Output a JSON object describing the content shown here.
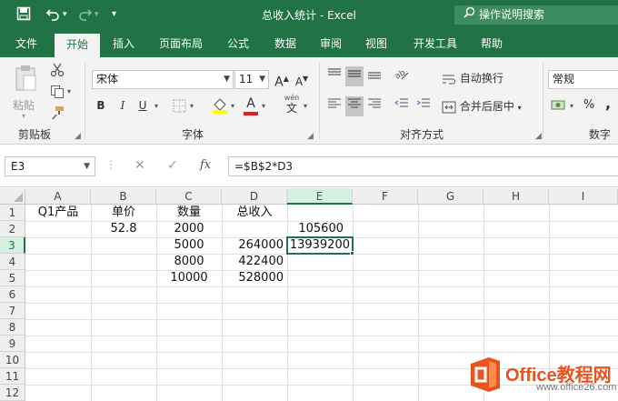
{
  "window": {
    "title": "总收入统计  -  Excel",
    "tell_me": "操作说明搜索"
  },
  "qat": {
    "save_icon": "save-icon",
    "undo_icon": "undo-icon",
    "redo_icon": "redo-icon",
    "more_icon": "customize-qat-icon"
  },
  "tabs": [
    {
      "id": "file",
      "label": "文件"
    },
    {
      "id": "home",
      "label": "开始"
    },
    {
      "id": "insert",
      "label": "插入"
    },
    {
      "id": "layout",
      "label": "页面布局"
    },
    {
      "id": "formulas",
      "label": "公式"
    },
    {
      "id": "data",
      "label": "数据"
    },
    {
      "id": "review",
      "label": "审阅"
    },
    {
      "id": "view",
      "label": "视图"
    },
    {
      "id": "developer",
      "label": "开发工具"
    },
    {
      "id": "help",
      "label": "帮助"
    }
  ],
  "ribbon": {
    "clipboard": {
      "label": "剪贴板",
      "paste": "粘贴"
    },
    "font": {
      "label": "字体",
      "name": "宋体",
      "size": "11",
      "bold": "B",
      "italic": "I",
      "underline": "U",
      "grow": "A",
      "shrink": "A",
      "fill_letter": "A",
      "wen": "wén",
      "wen_char": "文"
    },
    "alignment": {
      "label": "对齐方式",
      "wrap": "自动换行",
      "merge": "合并后居中"
    },
    "number": {
      "label": "数字",
      "format": "常规",
      "percent": "%",
      "comma": ","
    }
  },
  "formula_bar": {
    "name_box": "E3",
    "fx": "fx",
    "formula": "=$B$2*D3"
  },
  "columns": [
    "A",
    "B",
    "C",
    "D",
    "E",
    "F",
    "G",
    "H",
    "I"
  ],
  "rows": [
    "1",
    "2",
    "3",
    "4",
    "5",
    "6",
    "7",
    "8",
    "9",
    "10",
    "11",
    "12"
  ],
  "cells": {
    "A1": "Q1产品",
    "B1": "单价",
    "C1": "数量",
    "D1": "总收入",
    "B2": "52.8",
    "C2": "2000",
    "E2": "105600",
    "C3": "5000",
    "D3": "264000",
    "E3": "13939200",
    "C4": "8000",
    "D4": "422400",
    "C5": "10000",
    "D5": "528000"
  },
  "watermark": {
    "text": "Office教程网",
    "url": "www.office26.com"
  },
  "colors": {
    "accent": "#217346",
    "watermark": "#e8541e"
  }
}
